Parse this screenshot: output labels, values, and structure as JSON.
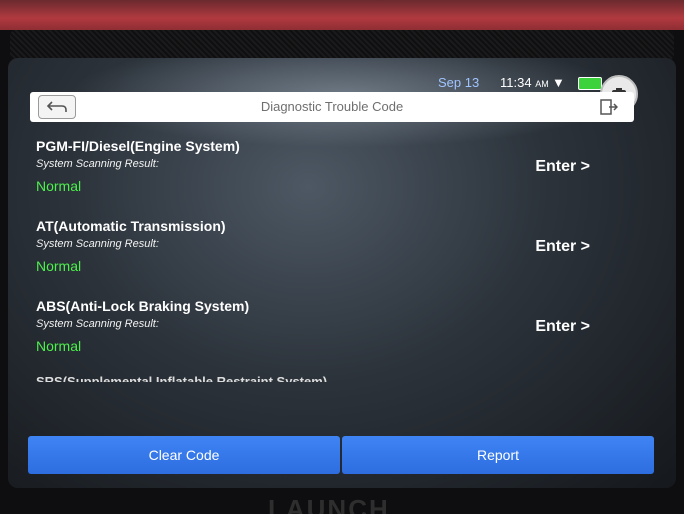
{
  "status_bar": {
    "date": "Sep 13",
    "time": "11:34",
    "ampm": "AM"
  },
  "header": {
    "title": "Diagnostic Trouble Code"
  },
  "systems": [
    {
      "name": "PGM-FI/Diesel(Engine System)",
      "result_label": "System Scanning Result:",
      "result": "Normal",
      "action": "Enter >"
    },
    {
      "name": "AT(Automatic Transmission)",
      "result_label": "System Scanning Result:",
      "result": "Normal",
      "action": "Enter >"
    },
    {
      "name": "ABS(Anti-Lock Braking System)",
      "result_label": "System Scanning Result:",
      "result": "Normal",
      "action": "Enter >"
    }
  ],
  "partial_item": {
    "name": "SRS(Supplemental Inflatable Restraint System)"
  },
  "actions": {
    "clear": "Clear Code",
    "report": "Report"
  },
  "brand": "LAUNCH",
  "colors": {
    "status_normal": "#4cf04c",
    "button_blue": "#2d6de0"
  }
}
